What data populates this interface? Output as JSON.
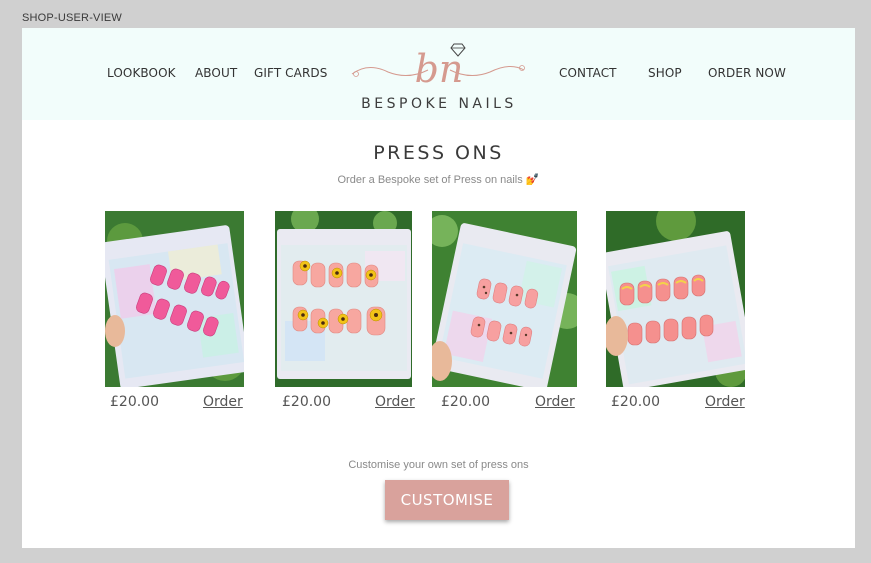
{
  "view_label": "SHOP-USER-VIEW",
  "nav": {
    "left": [
      "LOOKBOOK",
      "ABOUT",
      "GIFT CARDS"
    ],
    "right": [
      "CONTACT",
      "SHOP",
      "ORDER NOW"
    ]
  },
  "logo": {
    "monogram": "bn",
    "name": "BESPOKE NAILS"
  },
  "main": {
    "title": "PRESS ONS",
    "subtitle": "Order a Bespoke set of Press on nails 💅",
    "products": [
      {
        "price": "£20.00",
        "order_label": "Order",
        "nail_color": "#f05a9a",
        "design": "pink-square"
      },
      {
        "price": "£20.00",
        "order_label": "Order",
        "nail_color": "#f7a7a0",
        "design": "sunflower"
      },
      {
        "price": "£20.00",
        "order_label": "Order",
        "nail_color": "#f7a0a0",
        "design": "leopard"
      },
      {
        "price": "£20.00",
        "order_label": "Order",
        "nail_color": "#f5908e",
        "design": "french-tip"
      }
    ],
    "customise": {
      "text": "Customise your own set of press ons",
      "button_label": "CUSTOMISE"
    }
  },
  "colors": {
    "header_bg": "#f2fdfb",
    "accent": "#d9a29c",
    "logo_pink": "#d59a8f"
  }
}
